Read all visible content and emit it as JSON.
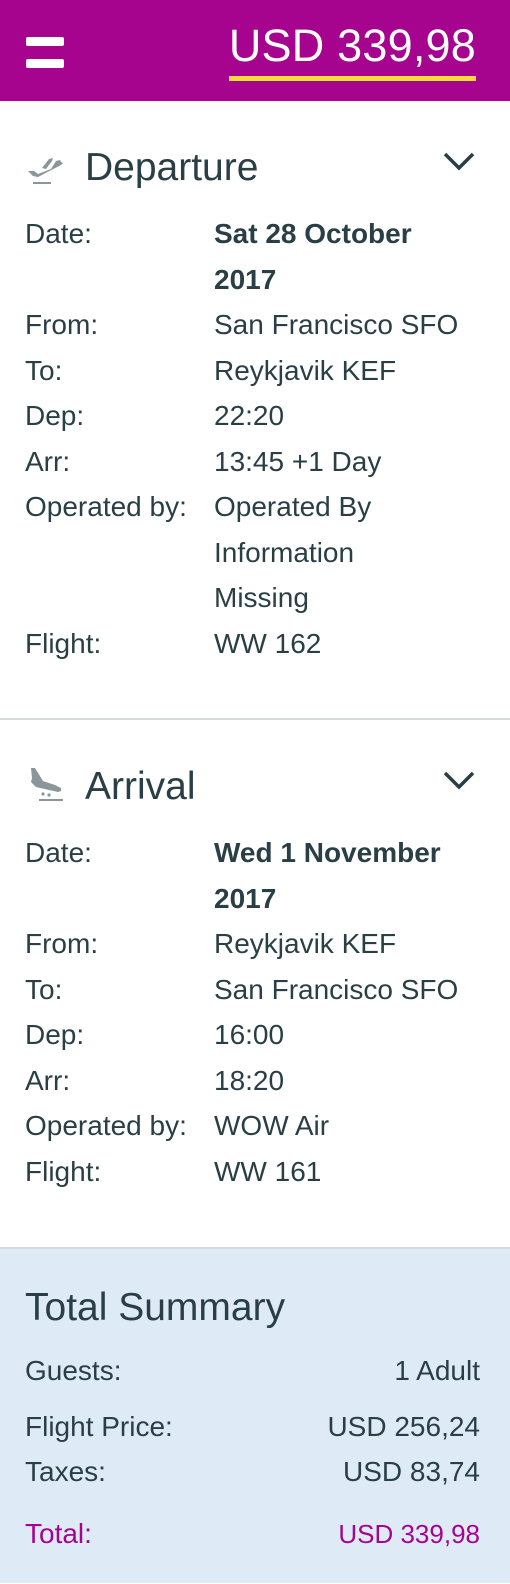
{
  "header": {
    "total_label": "USD 339,98"
  },
  "departure": {
    "title": "Departure",
    "rows": [
      {
        "label": "Date:",
        "value_line1": "Sat 28 October",
        "value_line2": "2017"
      },
      {
        "label": "From:",
        "value": "San Francisco SFO"
      },
      {
        "label": "To:",
        "value": "Reykjavik KEF"
      },
      {
        "label": "Dep:",
        "value": "22:20"
      },
      {
        "label": "Arr:",
        "value": "13:45 +1 Day"
      },
      {
        "label": "Operated by:",
        "value_line1": "Operated By",
        "value_line2": "Information",
        "value_line3": "Missing"
      },
      {
        "label": "Flight:",
        "value": "WW 162"
      }
    ]
  },
  "arrival": {
    "title": "Arrival",
    "rows": [
      {
        "label": "Date:",
        "value_line1": "Wed 1 November",
        "value_line2": "2017"
      },
      {
        "label": "From:",
        "value": "Reykjavik KEF"
      },
      {
        "label": "To:",
        "value": "San Francisco SFO"
      },
      {
        "label": "Dep:",
        "value": "16:00"
      },
      {
        "label": "Arr:",
        "value": "18:20"
      },
      {
        "label": "Operated by:",
        "value": "WOW Air"
      },
      {
        "label": "Flight:",
        "value": "WW 161"
      }
    ]
  },
  "summary": {
    "title": "Total Summary",
    "guests_label": "Guests:",
    "guests_value": "1 Adult",
    "price_label": "Flight Price:",
    "price_value": "USD 256,24",
    "taxes_label": "Taxes:",
    "taxes_value": "USD 83,74",
    "total_label": "Total:",
    "total_value": "USD 339,98"
  },
  "icons": {
    "menu": "hamburger-menu-icon",
    "departure": "plane-takeoff-icon",
    "arrival": "plane-landing-icon",
    "expand": "chevron-down-icon"
  },
  "colors": {
    "brand": "#a6048f",
    "underline": "#f5dd36",
    "text": "#2a3f45",
    "summary_bg": "#deeaf6"
  }
}
